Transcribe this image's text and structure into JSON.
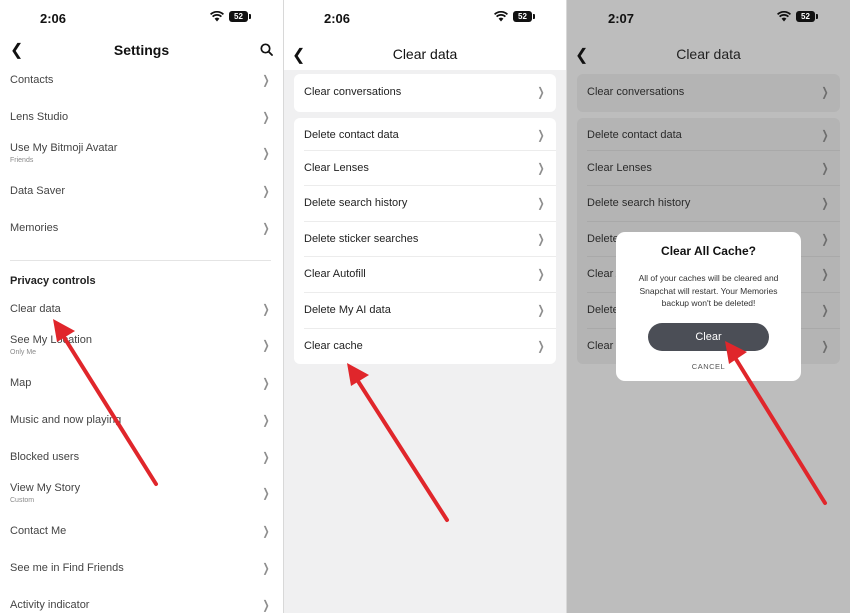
{
  "screens": [
    {
      "time": "2:06",
      "battery": "52",
      "title": "Settings",
      "rows": [
        {
          "label": "Contacts"
        },
        {
          "label": "Lens Studio"
        },
        {
          "label": "Use My Bitmoji Avatar",
          "sub": "Friends"
        },
        {
          "label": "Data Saver"
        },
        {
          "label": "Memories"
        }
      ],
      "section": "Privacy controls",
      "privacy_rows": [
        {
          "label": "Clear data"
        },
        {
          "label": "See My Location",
          "sub": "Only Me"
        },
        {
          "label": "Map"
        },
        {
          "label": "Music and now playing"
        },
        {
          "label": "Blocked users"
        },
        {
          "label": "View My Story",
          "sub": "Custom"
        },
        {
          "label": "Contact Me"
        },
        {
          "label": "See me in Find Friends"
        },
        {
          "label": "Activity indicator"
        }
      ]
    },
    {
      "time": "2:06",
      "battery": "52",
      "title": "Clear data",
      "top_item": "Clear conversations",
      "items": [
        "Delete contact data",
        "Clear Lenses",
        "Delete search history",
        "Delete sticker searches",
        "Clear Autofill",
        "Delete My AI data",
        "Clear cache"
      ]
    },
    {
      "time": "2:07",
      "battery": "52",
      "title": "Clear data",
      "top_item": "Clear conversations",
      "items": [
        "Delete contact data",
        "Clear Lenses",
        "Delete search history",
        "Delete sticker searches",
        "Clear Autofill",
        "Delete My AI data",
        "Clear cache"
      ],
      "dialog": {
        "title": "Clear All Cache?",
        "message": "All of your caches will be cleared and Snapchat will restart. Your Memories backup won't be deleted!",
        "confirm": "Clear",
        "cancel": "CANCEL"
      }
    }
  ],
  "icons": {
    "back": "back-chevron-icon",
    "search": "search-icon",
    "row": "chevron-right-icon",
    "wifi": "wifi-icon",
    "battery": "battery-icon",
    "pointer": "red-arrow-pointer"
  },
  "colors": {
    "arrow": "#e0262b",
    "dialog_button": "#4b4e56",
    "dim_background": "#bdbdbd"
  }
}
